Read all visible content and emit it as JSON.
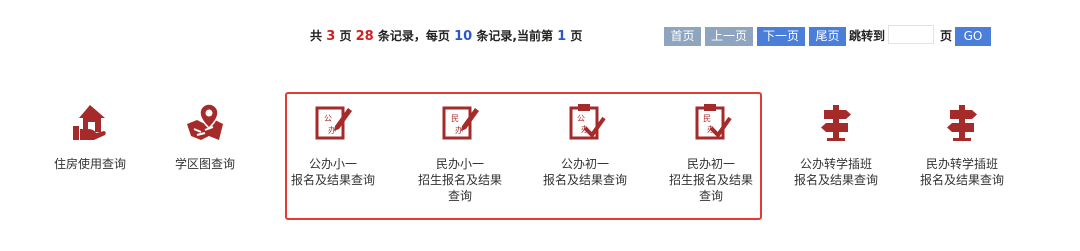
{
  "pager": {
    "prefix": "共",
    "total_pages": "3",
    "pages_unit": "页",
    "total_records": "28",
    "records_text": "条记录，每页",
    "per_page": "10",
    "current_text": "条记录,当前第",
    "current_page": "1",
    "current_unit": "页",
    "first_label": "首页",
    "prev_label": "上一页",
    "next_label": "下一页",
    "last_label": "尾页",
    "jump_label": "跳转到",
    "page_input_value": "",
    "page_unit": "页",
    "go_label": "GO"
  },
  "items": [
    {
      "label_lines": [
        "住房使用查询"
      ],
      "icon": "house-hand-icon"
    },
    {
      "label_lines": [
        "学区图查询"
      ],
      "icon": "map-pin-icon"
    },
    {
      "label_lines": [
        "公办小一",
        "报名及结果查询"
      ],
      "icon": "form-pen-icon",
      "badge": [
        "公",
        "办"
      ]
    },
    {
      "label_lines": [
        "民办小一",
        "招生报名及结果",
        "查询"
      ],
      "icon": "form-pen-icon",
      "badge": [
        "民",
        "办"
      ]
    },
    {
      "label_lines": [
        "公办初一",
        "报名及结果查询"
      ],
      "icon": "clipboard-check-icon",
      "badge": [
        "公",
        "办"
      ]
    },
    {
      "label_lines": [
        "民办初一",
        "招生报名及结果",
        "查询"
      ],
      "icon": "clipboard-check-icon",
      "badge": [
        "民",
        "办"
      ]
    },
    {
      "label_lines": [
        "公办转学插班",
        "报名及结果查询"
      ],
      "icon": "signpost-icon"
    },
    {
      "label_lines": [
        "民办转学插班",
        "报名及结果查询"
      ],
      "icon": "signpost-icon"
    }
  ],
  "colors": {
    "icon": "#a52a2a",
    "highlight": "#e53a2f",
    "number_red": "#d3201c",
    "number_blue": "#2a59c6",
    "btn_grey": "#8fa4bf",
    "btn_blue": "#4b7ed8"
  }
}
